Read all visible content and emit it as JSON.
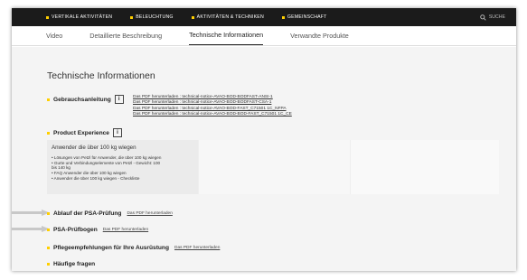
{
  "topnav": {
    "items": [
      {
        "label": "VERTIKALE AKTIVITÄTEN"
      },
      {
        "label": "BELEUCHTUNG"
      },
      {
        "label": "AKTIVITÄTEN & TECHNIKEN"
      },
      {
        "label": "GEMEINSCHAFT"
      }
    ],
    "search_label": "SUCHE"
  },
  "tabs": [
    {
      "label": "Video",
      "active": false
    },
    {
      "label": "Detaillierte Beschreibung",
      "active": false
    },
    {
      "label": "Technische Informationen",
      "active": true
    },
    {
      "label": "Verwandte Produkte",
      "active": false
    }
  ],
  "main": {
    "title": "Technische Informationen",
    "manual": {
      "label": "Gebrauchsanleitung",
      "icon": "info-document-icon",
      "links": [
        "Das PDF herunterladen : technical-notice-AVAO-BOD-BODFAST-ANSI-1",
        "Das PDF herunterladen : technical-notice-AVAO-BOD-BODFAST-CSA-1",
        "Das PDF herunterladen : technical-notice-AVAO-BOD-FAST_C71501 1C_NFPA",
        "Das PDF herunterladen : technical-notice-AVAO-BOD-BOD-FAST_C71501 1C_CE"
      ]
    },
    "product_experience": {
      "label": "Product Experience",
      "icon": "product-experience-icon",
      "heading": "Anwender die über 100 kg wiegen",
      "items": [
        "• Lösungen von Petzl für Anwender, die über 100 kg wiegen",
        "• Gurte und Verbindungselemente von Petzl - Gewicht: 100",
        "bis 140 kg",
        "• FAQ Anwender die über 100 kg wiegen",
        "• Anwender die über 100 kg wiegen - Checkliste"
      ]
    },
    "psa_pruefung": {
      "label": "Ablauf der PSA-Prüfung",
      "link": "Das PDF herunterladen"
    },
    "psa_pruefbogen": {
      "label": "PSA-Prüfbogen",
      "link": "Das PDF herunterladen"
    },
    "pflege": {
      "label": "Pflegeempfehlungen für Ihre Ausrüstung",
      "link": "Das PDF herunterladen"
    },
    "faq": {
      "label": "Häufige fragen"
    }
  },
  "colors": {
    "accent": "#ffcf00",
    "nav_bg": "#1b1b1b",
    "content_bg": "#f4f4f4",
    "arrow": "#c8c8c8"
  }
}
